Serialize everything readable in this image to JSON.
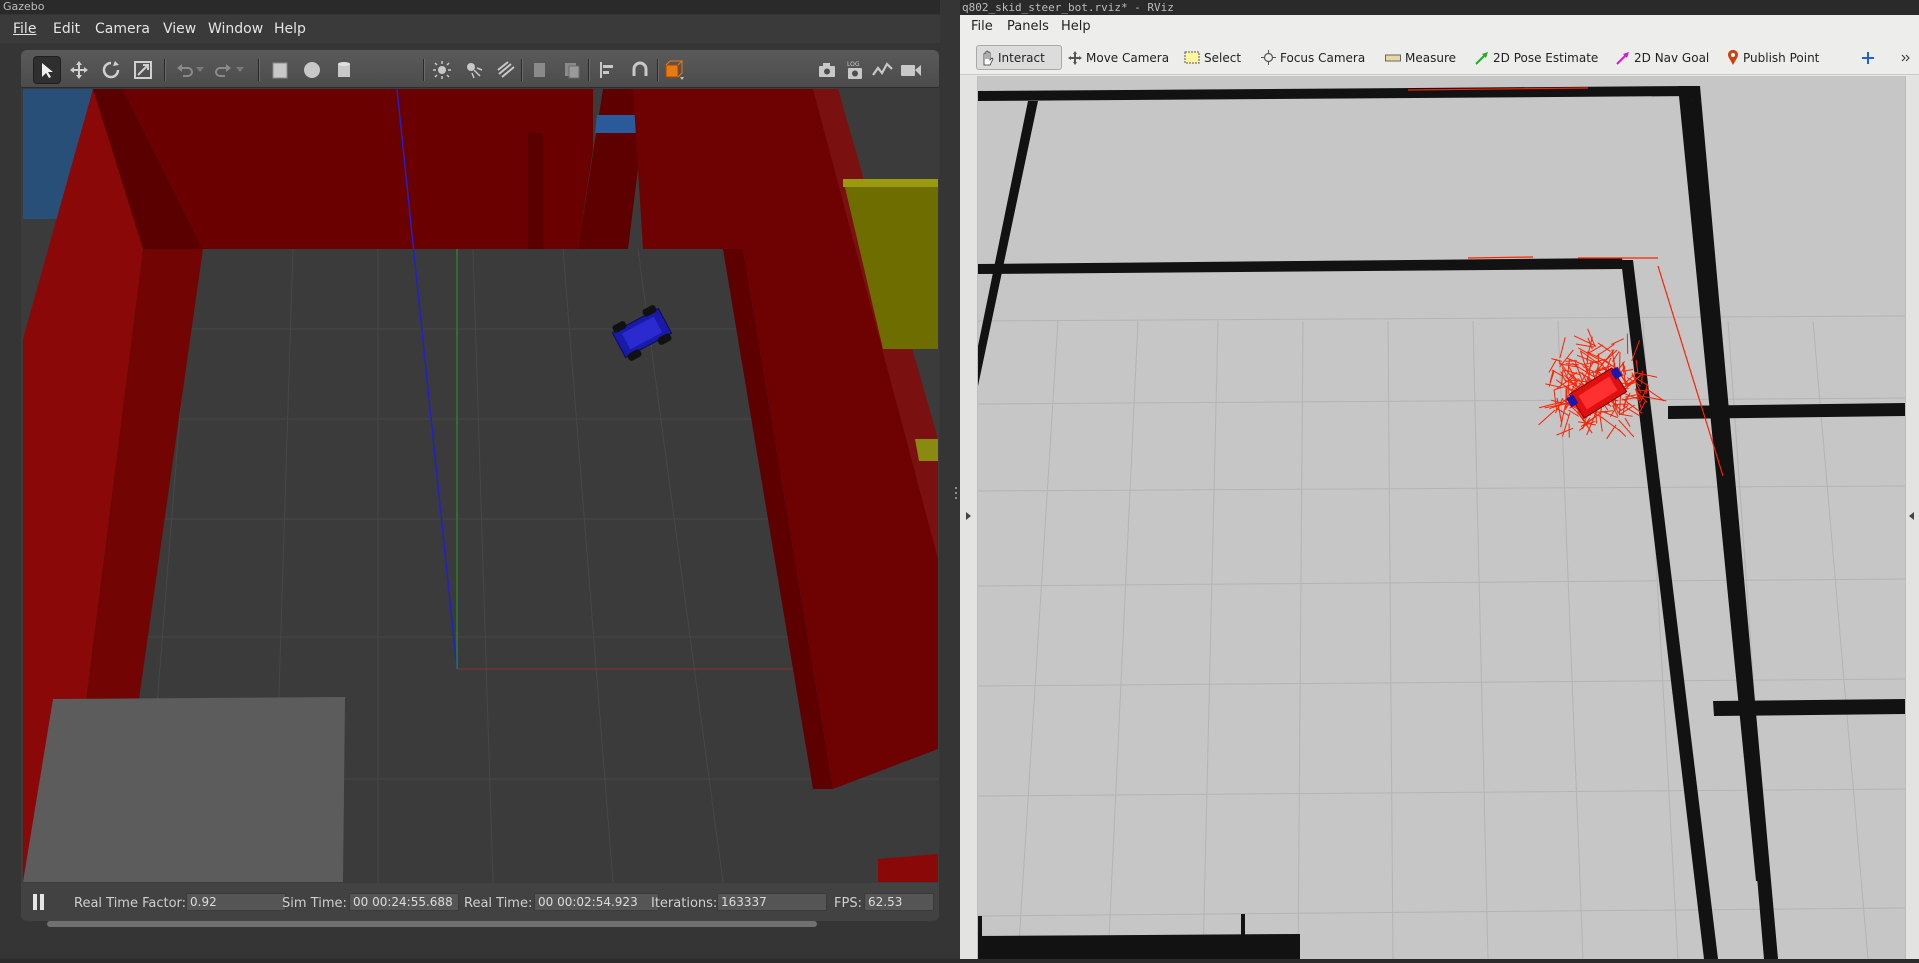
{
  "gazebo": {
    "window_title": "Gazebo",
    "menu": [
      "File",
      "Edit",
      "Camera",
      "View",
      "Window",
      "Help"
    ],
    "status": {
      "real_time_factor_label": "Real Time Factor:",
      "real_time_factor": "0.92",
      "sim_time_label": "Sim Time:",
      "sim_time": "00 00:24:55.688",
      "real_time_label": "Real Time:",
      "real_time": "00 00:02:54.923",
      "iterations_label": "Iterations:",
      "iterations": "163337",
      "fps_label": "FPS:",
      "fps": "62.53"
    },
    "colors": {
      "wall": "#6b0000",
      "floor": "#3a3a3a",
      "robot": "#1010a0"
    }
  },
  "rviz": {
    "window_title": "q802_skid_steer_bot.rviz* - RViz",
    "menu": [
      "File",
      "Panels",
      "Help"
    ],
    "toolbar": {
      "interact": "Interact",
      "move_camera": "Move Camera",
      "select": "Select",
      "focus_camera": "Focus Camera",
      "measure": "Measure",
      "pose_estimate": "2D Pose Estimate",
      "nav_goal": "2D Nav Goal",
      "publish_point": "Publish Point"
    },
    "colors": {
      "map_free": "#c8c8c8",
      "map_wall": "#111111",
      "particles": "#ff2000"
    }
  }
}
